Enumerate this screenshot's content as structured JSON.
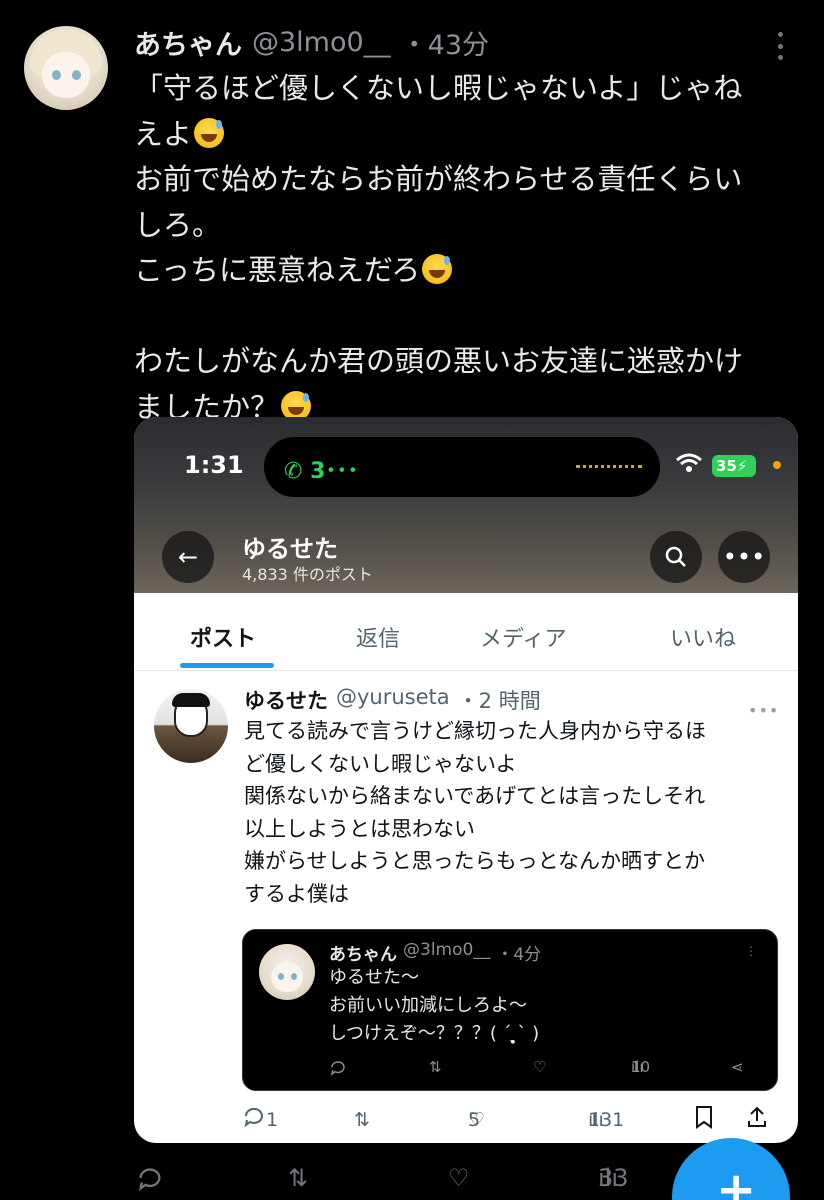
{
  "tweet": {
    "display_name": "あちゃん",
    "handle": "@3lmo0__",
    "time": "・43分",
    "lines": [
      "「守るほど優しくないし暇じゃないよ」じゃね",
      "えよ",
      "お前で始めたならお前が終わらせる責任くらい",
      "しろ。",
      "こっちに悪意ねえだろ",
      "",
      "わたしがなんか君の頭の悪いお友達に迷惑かけ",
      "ましたか？"
    ],
    "actions": {
      "views": "33"
    }
  },
  "screenshot_card": {
    "status_bar": {
      "time": "1:31",
      "call": "3･･･",
      "battery": "35"
    },
    "profile": {
      "name": "ゆるせた",
      "post_count": "4,833 件のポスト"
    },
    "tabs": [
      "ポスト",
      "返信",
      "メディア",
      "いいね"
    ],
    "post": {
      "display_name": "ゆるせた",
      "handle": "@yuruseta",
      "time": "・2 時間",
      "lines": [
        "見てる読みで言うけど縁切った人身内から守るほ",
        "ど優しくないし暇じゃないよ",
        "関係ないから絡まないであげてとは言ったしそれ",
        "以上しようとは思わない",
        "嫌がらせしようと思ったらもっとなんか晒すとか",
        "するよ僕は"
      ],
      "actions": {
        "replies": "1",
        "likes": "5",
        "views": "131"
      }
    },
    "quoted": {
      "display_name": "あちゃん",
      "handle": "@3lmo0__",
      "time": "・4分",
      "lines": [
        "ゆるせた〜",
        "お前いい加減にしろよ〜",
        "しつけえぞ〜？？？( ˊ ̖̥̣̥̥ˋ )"
      ],
      "actions": {
        "views": "10"
      }
    }
  },
  "colors": {
    "accent": "#1d9bf0",
    "dark_bg": "#000000",
    "secondary_text": "#71767b"
  }
}
